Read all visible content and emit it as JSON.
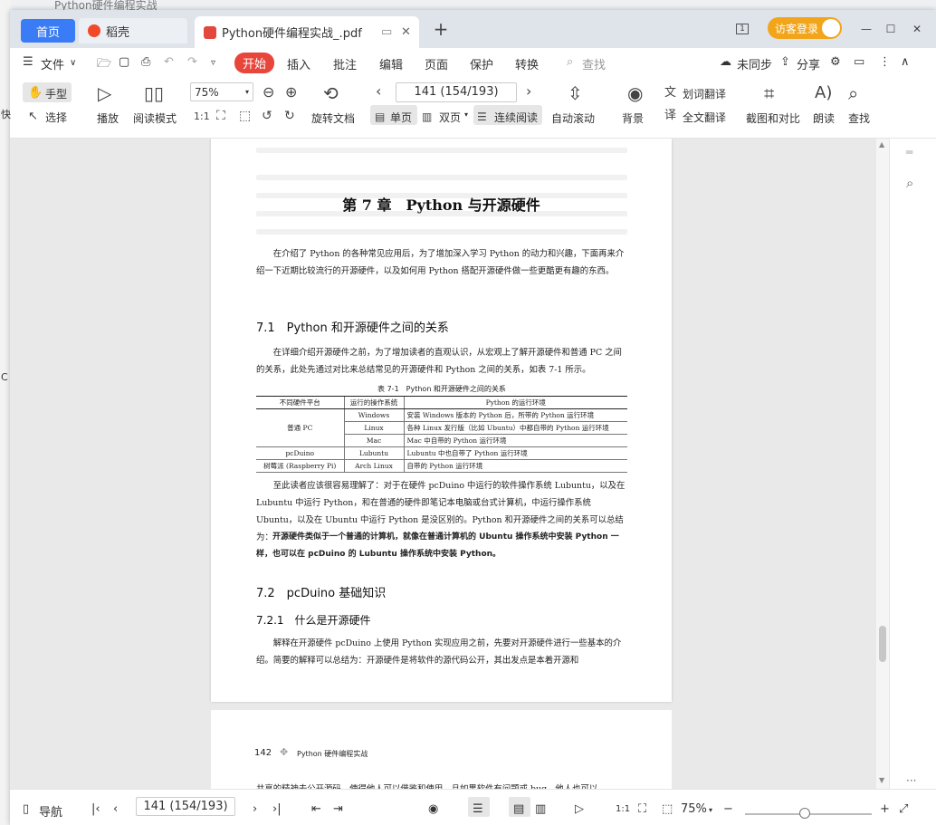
{
  "background": {
    "window_title": "Python硬件编程实战"
  },
  "tabs": [
    {
      "label": "首页"
    },
    {
      "label": "稻壳"
    },
    {
      "label": "Python硬件编程实战_.pdf"
    }
  ],
  "topbar": {
    "login_label": "访客登录",
    "layout_badge": "1"
  },
  "menu": {
    "file": "文件",
    "start": "开始",
    "insert": "插入",
    "annotate": "批注",
    "edit": "编辑",
    "page": "页面",
    "protect": "保护",
    "convert": "转换",
    "search": "查找",
    "unsync": "未同步",
    "share": "分享"
  },
  "ribbon": {
    "hand": "手型",
    "select": "选择",
    "play": "播放",
    "read_mode": "阅读模式",
    "zoom": "75%",
    "rotate": "旋转文档",
    "page_input": "141 (154/193)",
    "single": "单页",
    "double": "双页",
    "continuous": "连续阅读",
    "auto_scroll": "自动滚动",
    "background": "背景",
    "word_translate": "划词翻译",
    "full_translate": "全文翻译",
    "screenshot_compare": "截图和对比",
    "read_aloud": "朗读",
    "find": "查找"
  },
  "doc": {
    "chapter_title": "第 7 章　Python 与开源硬件",
    "intro": "在介绍了 Python 的各种常见应用后，为了增加深入学习 Python 的动力和兴趣，下面再来介绍一下近期比较流行的开源硬件，以及如何用 Python 搭配开源硬件做一些更酷更有趣的东西。",
    "s71": "7.1　Python 和开源硬件之间的关系",
    "p71": "在详细介绍开源硬件之前，为了增加读者的直观认识，从宏观上了解开源硬件和普通 PC 之间的关系，此处先通过对比来总结常见的开源硬件和 Python 之间的关系，如表 7-1 所示。",
    "table_caption": "表 7-1　Python 和开源硬件之间的关系",
    "table_headers": [
      "不同硬件平台",
      "运行的操作系统",
      "Python 的运行环境"
    ],
    "table_rows": [
      [
        "普通 PC",
        "Windows",
        "安装 Windows 版本的 Python 后，所带的 Python 运行环境"
      ],
      [
        "",
        "Linux",
        "各种 Linux 发行版（比如 Ubuntu）中都自带的 Python 运行环境"
      ],
      [
        "",
        "Mac",
        "Mac 中自带的 Python 运行环境"
      ],
      [
        "pcDuino",
        "Lubuntu",
        "Lubuntu 中也自带了 Python 运行环境"
      ],
      [
        "树莓派 (Raspberry Pi)",
        "Arch Linux",
        "自带的 Python 运行环境"
      ]
    ],
    "p_after": "至此读者应该很容易理解了：对于在硬件 pcDuino 中运行的软件操作系统 Lubuntu，以及在 Lubuntu 中运行 Python，和在普通的硬件即笔记本电脑或台式计算机，中运行操作系统 Ubuntu，以及在 Ubuntu 中运行 Python 是没区别的。Python 和开源硬件之间的关系可以总结为：",
    "p_bold": "开源硬件类似于一个普通的计算机，就像在普通计算机的 Ubuntu 操作系统中安装 Python 一样，也可以在 pcDuino 的 Lubuntu 操作系统中安装 Python。",
    "s72": "7.2　pcDuino 基础知识",
    "s721": "7.2.1　什么是开源硬件",
    "p721": "解释在开源硬件 pcDuino 上使用 Python 实现应用之前，先要对开源硬件进行一些基本的介绍。简要的解释可以总结为：开源硬件是将软件的源代码公开，其出发点是本着开源和",
    "page2_num": "142",
    "page2_header": "Python 硬件编程实战",
    "page2_text": "共享的精神去公开源码，使得他人可以借鉴和使用，且如果软件有问题或 bug，他人也可以"
  },
  "status": {
    "nav": "导航",
    "page": "141 (154/193)",
    "zoom": "75%"
  }
}
